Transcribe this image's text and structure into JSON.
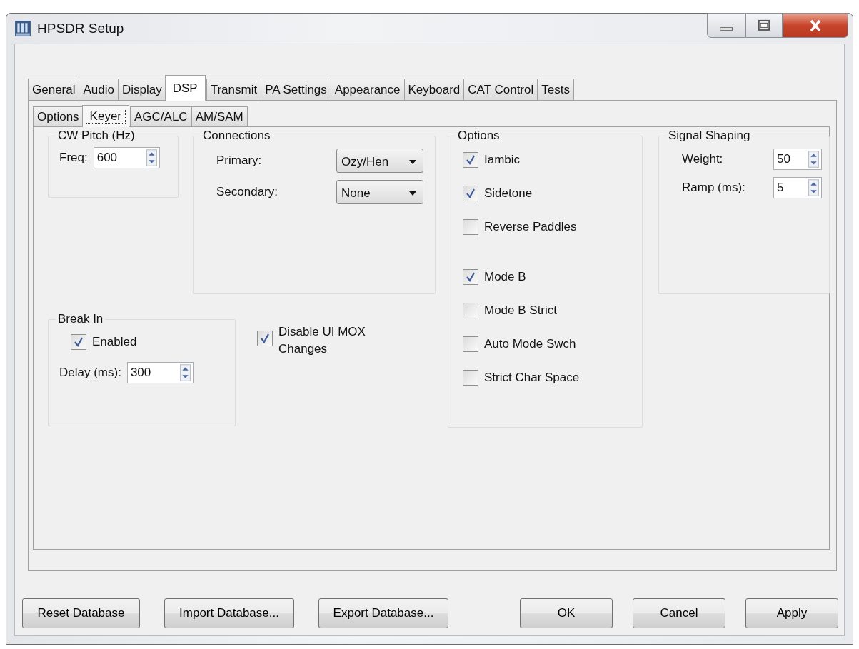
{
  "window": {
    "title": "HPSDR Setup"
  },
  "tabs": [
    {
      "label": "General",
      "selected": false
    },
    {
      "label": "Audio",
      "selected": false
    },
    {
      "label": "Display",
      "selected": false
    },
    {
      "label": "DSP",
      "selected": true
    },
    {
      "label": "Transmit",
      "selected": false
    },
    {
      "label": "PA Settings",
      "selected": false
    },
    {
      "label": "Appearance",
      "selected": false
    },
    {
      "label": "Keyboard",
      "selected": false
    },
    {
      "label": "CAT Control",
      "selected": false
    },
    {
      "label": "Tests",
      "selected": false
    }
  ],
  "subtabs": [
    {
      "label": "Options",
      "selected": false
    },
    {
      "label": "Keyer",
      "selected": true
    },
    {
      "label": "AGC/ALC",
      "selected": false
    },
    {
      "label": "AM/SAM",
      "selected": false
    }
  ],
  "cw_pitch": {
    "title": "CW Pitch (Hz)",
    "label": "Freq:",
    "value": "600"
  },
  "connections": {
    "title": "Connections",
    "rows": [
      {
        "label": "Primary:",
        "value": "Ozy/Hen"
      },
      {
        "label": "Secondary:",
        "value": "None"
      }
    ]
  },
  "break_in": {
    "title": "Break In",
    "enabled": {
      "label": "Enabled",
      "checked": true
    },
    "delay": {
      "label": "Delay (ms):",
      "value": "300"
    }
  },
  "disable_mox": {
    "label": "Disable UI MOX Changes",
    "checked": true
  },
  "options": {
    "title": "Options",
    "sets": [
      [
        {
          "label": "Iambic",
          "checked": true
        },
        {
          "label": "Sidetone",
          "checked": true
        },
        {
          "label": "Reverse Paddles",
          "checked": false
        }
      ],
      [
        {
          "label": "Mode B",
          "checked": true
        },
        {
          "label": "Mode B Strict",
          "checked": false
        },
        {
          "label": "Auto Mode Swch",
          "checked": false
        },
        {
          "label": "Strict Char Space",
          "checked": false
        }
      ]
    ]
  },
  "signal_shaping": {
    "title": "Signal Shaping",
    "rows": [
      {
        "label": "Weight:",
        "value": "50"
      },
      {
        "label": "Ramp (ms):",
        "value": "5"
      }
    ]
  },
  "buttons_left": [
    "Reset Database",
    "Import Database...",
    "Export Database..."
  ],
  "buttons_right": [
    "OK",
    "Cancel",
    "Apply"
  ]
}
